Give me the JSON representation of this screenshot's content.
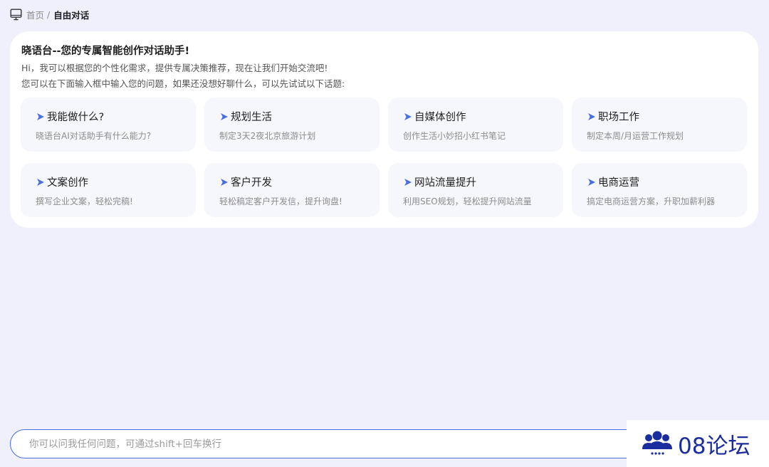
{
  "breadcrumb": {
    "home": "首页",
    "separator": "/",
    "current": "自由对话"
  },
  "welcome": {
    "title": "晓语台--您的专属智能创作对话助手!",
    "line1": "Hi，我可以根据您的个性化需求，提供专属决策推荐，现在让我们开始交流吧!",
    "line2": "您可以在下面输入框中输入您的问题，如果还没想好聊什么，可以先试试以下话题:"
  },
  "topics": [
    {
      "title": "我能做什么?",
      "desc": "晓语台AI对话助手有什么能力?"
    },
    {
      "title": "规划生活",
      "desc": "制定3天2夜北京旅游计划"
    },
    {
      "title": "自媒体创作",
      "desc": "创作生活小妙招小红书笔记"
    },
    {
      "title": "职场工作",
      "desc": "制定本周/月运营工作规划"
    },
    {
      "title": "文案创作",
      "desc": "撰写企业文案，轻松完稿!"
    },
    {
      "title": "客户开发",
      "desc": "轻松稿定客户开发信，提升询盘!"
    },
    {
      "title": "网站流量提升",
      "desc": "利用SEO规划，轻松提升网站流量"
    },
    {
      "title": "电商运营",
      "desc": "搞定电商运营方案，升职加薪利器"
    }
  ],
  "input": {
    "placeholder": "你可以问我任何问题，可通过shift+回车换行",
    "value": ""
  },
  "watermark": {
    "text": "08论坛"
  },
  "icons": {
    "breadcrumb": "monitor-icon",
    "topic": "arrow-right-icon",
    "watermark": "people-group-icon"
  },
  "colors": {
    "background": "#eff0fc",
    "accent": "#4a6ee0",
    "watermark": "#1b2c9e"
  }
}
